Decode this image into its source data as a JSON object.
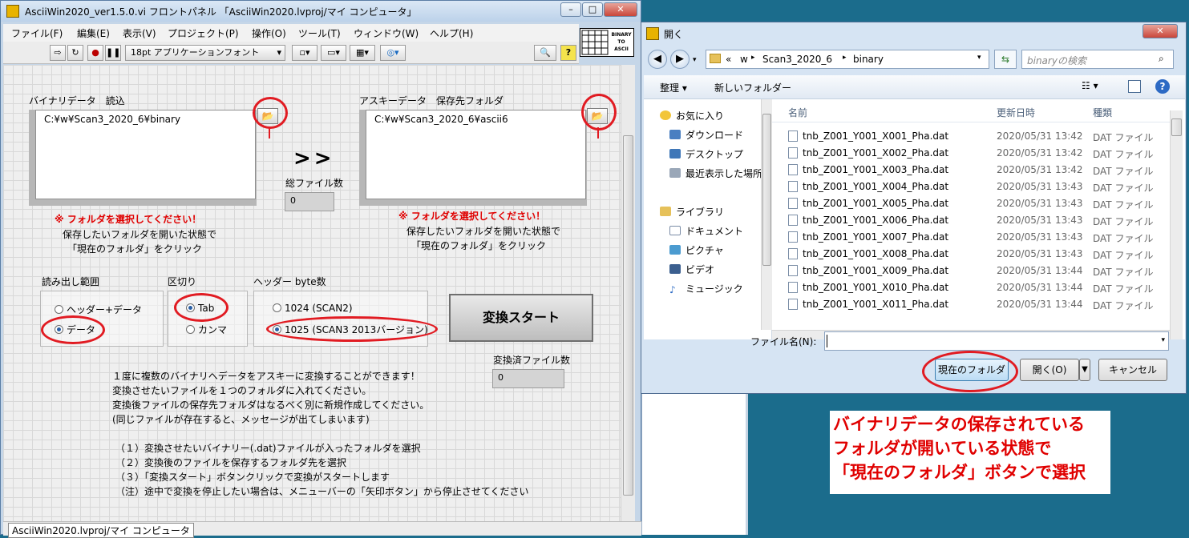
{
  "labview": {
    "title": "AsciiWin2020_ver1.5.0.vi フロントパネル 「AsciiWin2020.lvproj/マイ コンピュータ」",
    "menu": [
      "ファイル(F)",
      "編集(E)",
      "表示(V)",
      "プロジェクト(P)",
      "操作(O)",
      "ツール(T)",
      "ウィンドウ(W)",
      "ヘルプ(H)"
    ],
    "font_select": "18pt アプリケーションフォント",
    "vi_icon_text": [
      "BINARY",
      "TO",
      "ASCII"
    ],
    "binary": {
      "label": "バイナリデータ　読込",
      "path": "C:¥w¥Scan3_2020_6¥binary",
      "warning": "※ フォルダを選択してください！",
      "hint1": "保存したいフォルダを開いた状態で",
      "hint2": "「現在のフォルダ」をクリック"
    },
    "ascii": {
      "label": "アスキーデータ　保存先フォルダ",
      "path": "C:¥w¥Scan3_2020_6¥ascii6",
      "warning": "※ フォルダを選択してください！",
      "hint1": "保存したいフォルダを開いた状態で",
      "hint2": "「現在のフォルダ」をクリック"
    },
    "arrow": ">>",
    "total_files": {
      "label": "総ファイル数",
      "value": "0"
    },
    "read_range": {
      "label": "読み出し範囲",
      "options": [
        "ヘッダー+データ",
        "データ"
      ],
      "selected": 1
    },
    "delimiter": {
      "label": "区切り",
      "options": [
        "Tab",
        "カンマ"
      ],
      "selected": 0
    },
    "header_bytes": {
      "label": "ヘッダー byte数",
      "options": [
        "1024 (SCAN2)",
        "1025 (SCAN3 2013バージョン)"
      ],
      "selected": 1
    },
    "start_button": "変換スタート",
    "converted_files": {
      "label": "変換済ファイル数",
      "value": "0"
    },
    "instructions": [
      "１度に複数のバイナリへデータをアスキーに変換することができます！",
      "変換させたいファイルを１つのフォルダに入れてください。",
      "変換後ファイルの保存先フォルダはなるべく別に新規作成してください。",
      "(同じファイルが存在すると、メッセージが出てしまいます)"
    ],
    "steps": [
      "（１）変換させたいバイナリー(.dat)ファイルが入ったフォルダを選択",
      "（２）変換後のファイルを保存するフォルダ先を選択",
      "（３）「変換スタート」ボタンクリックで変換がスタートします",
      "（注）途中で変換を停止したい場合は、メニューバーの「矢印ボタン」から停止させてください"
    ],
    "status": "AsciiWin2020.lvproj/マイ コンピュータ"
  },
  "dialog": {
    "title": "開く",
    "breadcrumb": [
      "«",
      "w",
      "Scan3_2020_6",
      "binary"
    ],
    "search_placeholder": "binaryの検索",
    "organize": "整理",
    "new_folder": "新しいフォルダー",
    "nav": {
      "favorites": "お気に入り",
      "favorite_items": [
        "ダウンロード",
        "デスクトップ",
        "最近表示した場所"
      ],
      "libraries": "ライブラリ",
      "library_items": [
        "ドキュメント",
        "ピクチャ",
        "ビデオ",
        "ミュージック"
      ]
    },
    "columns": {
      "name": "名前",
      "date": "更新日時",
      "type": "種類"
    },
    "files": [
      {
        "name": "tnb_Z001_Y001_X001_Pha.dat",
        "date": "2020/05/31 13:42",
        "type": "DAT ファイル"
      },
      {
        "name": "tnb_Z001_Y001_X002_Pha.dat",
        "date": "2020/05/31 13:42",
        "type": "DAT ファイル"
      },
      {
        "name": "tnb_Z001_Y001_X003_Pha.dat",
        "date": "2020/05/31 13:42",
        "type": "DAT ファイル"
      },
      {
        "name": "tnb_Z001_Y001_X004_Pha.dat",
        "date": "2020/05/31 13:43",
        "type": "DAT ファイル"
      },
      {
        "name": "tnb_Z001_Y001_X005_Pha.dat",
        "date": "2020/05/31 13:43",
        "type": "DAT ファイル"
      },
      {
        "name": "tnb_Z001_Y001_X006_Pha.dat",
        "date": "2020/05/31 13:43",
        "type": "DAT ファイル"
      },
      {
        "name": "tnb_Z001_Y001_X007_Pha.dat",
        "date": "2020/05/31 13:43",
        "type": "DAT ファイル"
      },
      {
        "name": "tnb_Z001_Y001_X008_Pha.dat",
        "date": "2020/05/31 13:43",
        "type": "DAT ファイル"
      },
      {
        "name": "tnb_Z001_Y001_X009_Pha.dat",
        "date": "2020/05/31 13:44",
        "type": "DAT ファイル"
      },
      {
        "name": "tnb_Z001_Y001_X010_Pha.dat",
        "date": "2020/05/31 13:44",
        "type": "DAT ファイル"
      },
      {
        "name": "tnb_Z001_Y001_X011_Pha.dat",
        "date": "2020/05/31 13:44",
        "type": "DAT ファイル"
      }
    ],
    "filename_label": "ファイル名(N):",
    "filename_value": "",
    "current_folder_button": "現在のフォルダ",
    "open_button": "開く(O)",
    "cancel_button": "キャンセル"
  },
  "annotation": [
    "バイナリデータの保存されている",
    "フォルダが開いている状態で",
    "「現在のフォルダ」ボタンで選択"
  ],
  "colors": {
    "annotation_red": "#e11b22",
    "desktop": "#1b6c8c"
  }
}
